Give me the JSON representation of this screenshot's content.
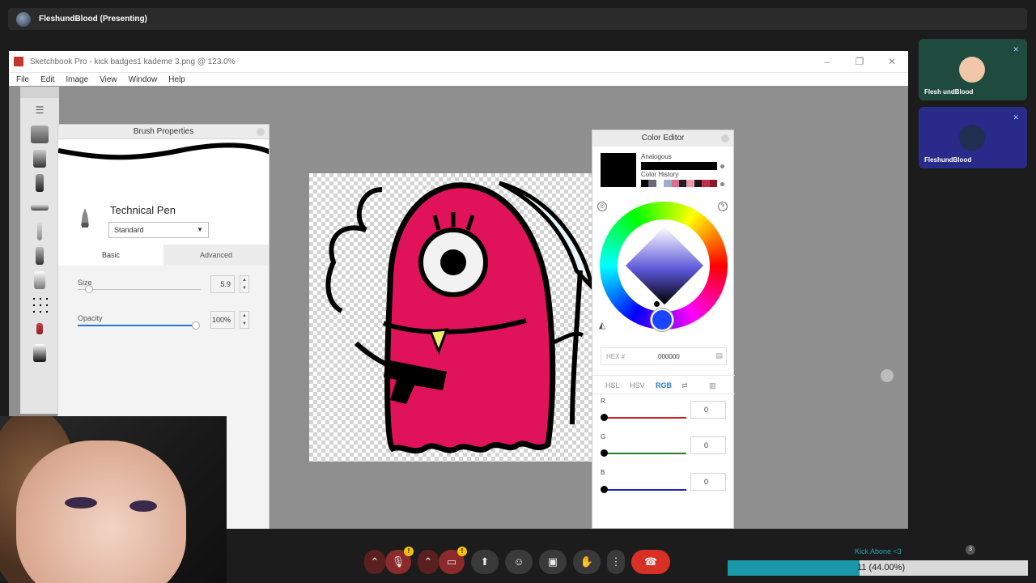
{
  "meet": {
    "presenting": "FleshundBlood (Presenting)",
    "participants": [
      {
        "name": "Flesh undBlood",
        "avatar_color": "#f2c6a8",
        "tile_color": "#1f4a3e"
      },
      {
        "name": "FleshundBlood",
        "avatar_color": "#203050",
        "tile_color": "#2a2a8a"
      }
    ],
    "controls": [
      "chevron-up-icon",
      "mic-off-icon",
      "chevron-up-icon",
      "camera-off-icon",
      "present-icon",
      "emoji-icon",
      "captions-icon",
      "hand-icon",
      "more-icon",
      "end-call-icon"
    ],
    "badge": "!",
    "participant_count": "3"
  },
  "sketchbook": {
    "title": "Sketchbook Pro - kick badges1 kademe 3.png @ 123.0%",
    "menu": [
      "File",
      "Edit",
      "Image",
      "View",
      "Window",
      "Help"
    ],
    "brush_panel": {
      "title": "Brush Properties",
      "brush_name": "Technical Pen",
      "preset": "Standard",
      "tabs": [
        "Basic",
        "Advanced"
      ],
      "size_label": "Size",
      "size_value": "5.9",
      "size_fraction": 0.04,
      "opacity_label": "Opacity",
      "opacity_value": "100%",
      "opacity_fraction": 1.0
    },
    "color_editor": {
      "title": "Color Editor",
      "analogous_label": "Analogous",
      "history_label": "Color History",
      "history_colors": [
        "#000000",
        "#6a6a7a",
        "#ffffff",
        "#9ab0c8",
        "#e06a90",
        "#222222",
        "#f09ab0",
        "#1a1a1a",
        "#c0304a",
        "#8a1a2a"
      ],
      "hex_label": "HEX #",
      "hex_value": "000000",
      "modes": [
        "HSL",
        "HSV",
        "RGB"
      ],
      "active_mode": "RGB",
      "channels": [
        {
          "label": "R",
          "value": "0",
          "color": "#d02020"
        },
        {
          "label": "G",
          "value": "0",
          "color": "#208020"
        },
        {
          "label": "B",
          "value": "0",
          "color": "#2020c0"
        }
      ]
    }
  },
  "stream": {
    "kick_label": "Kick Abone <3",
    "progress_text": "11 (44.00%)",
    "progress_fraction": 0.44
  }
}
